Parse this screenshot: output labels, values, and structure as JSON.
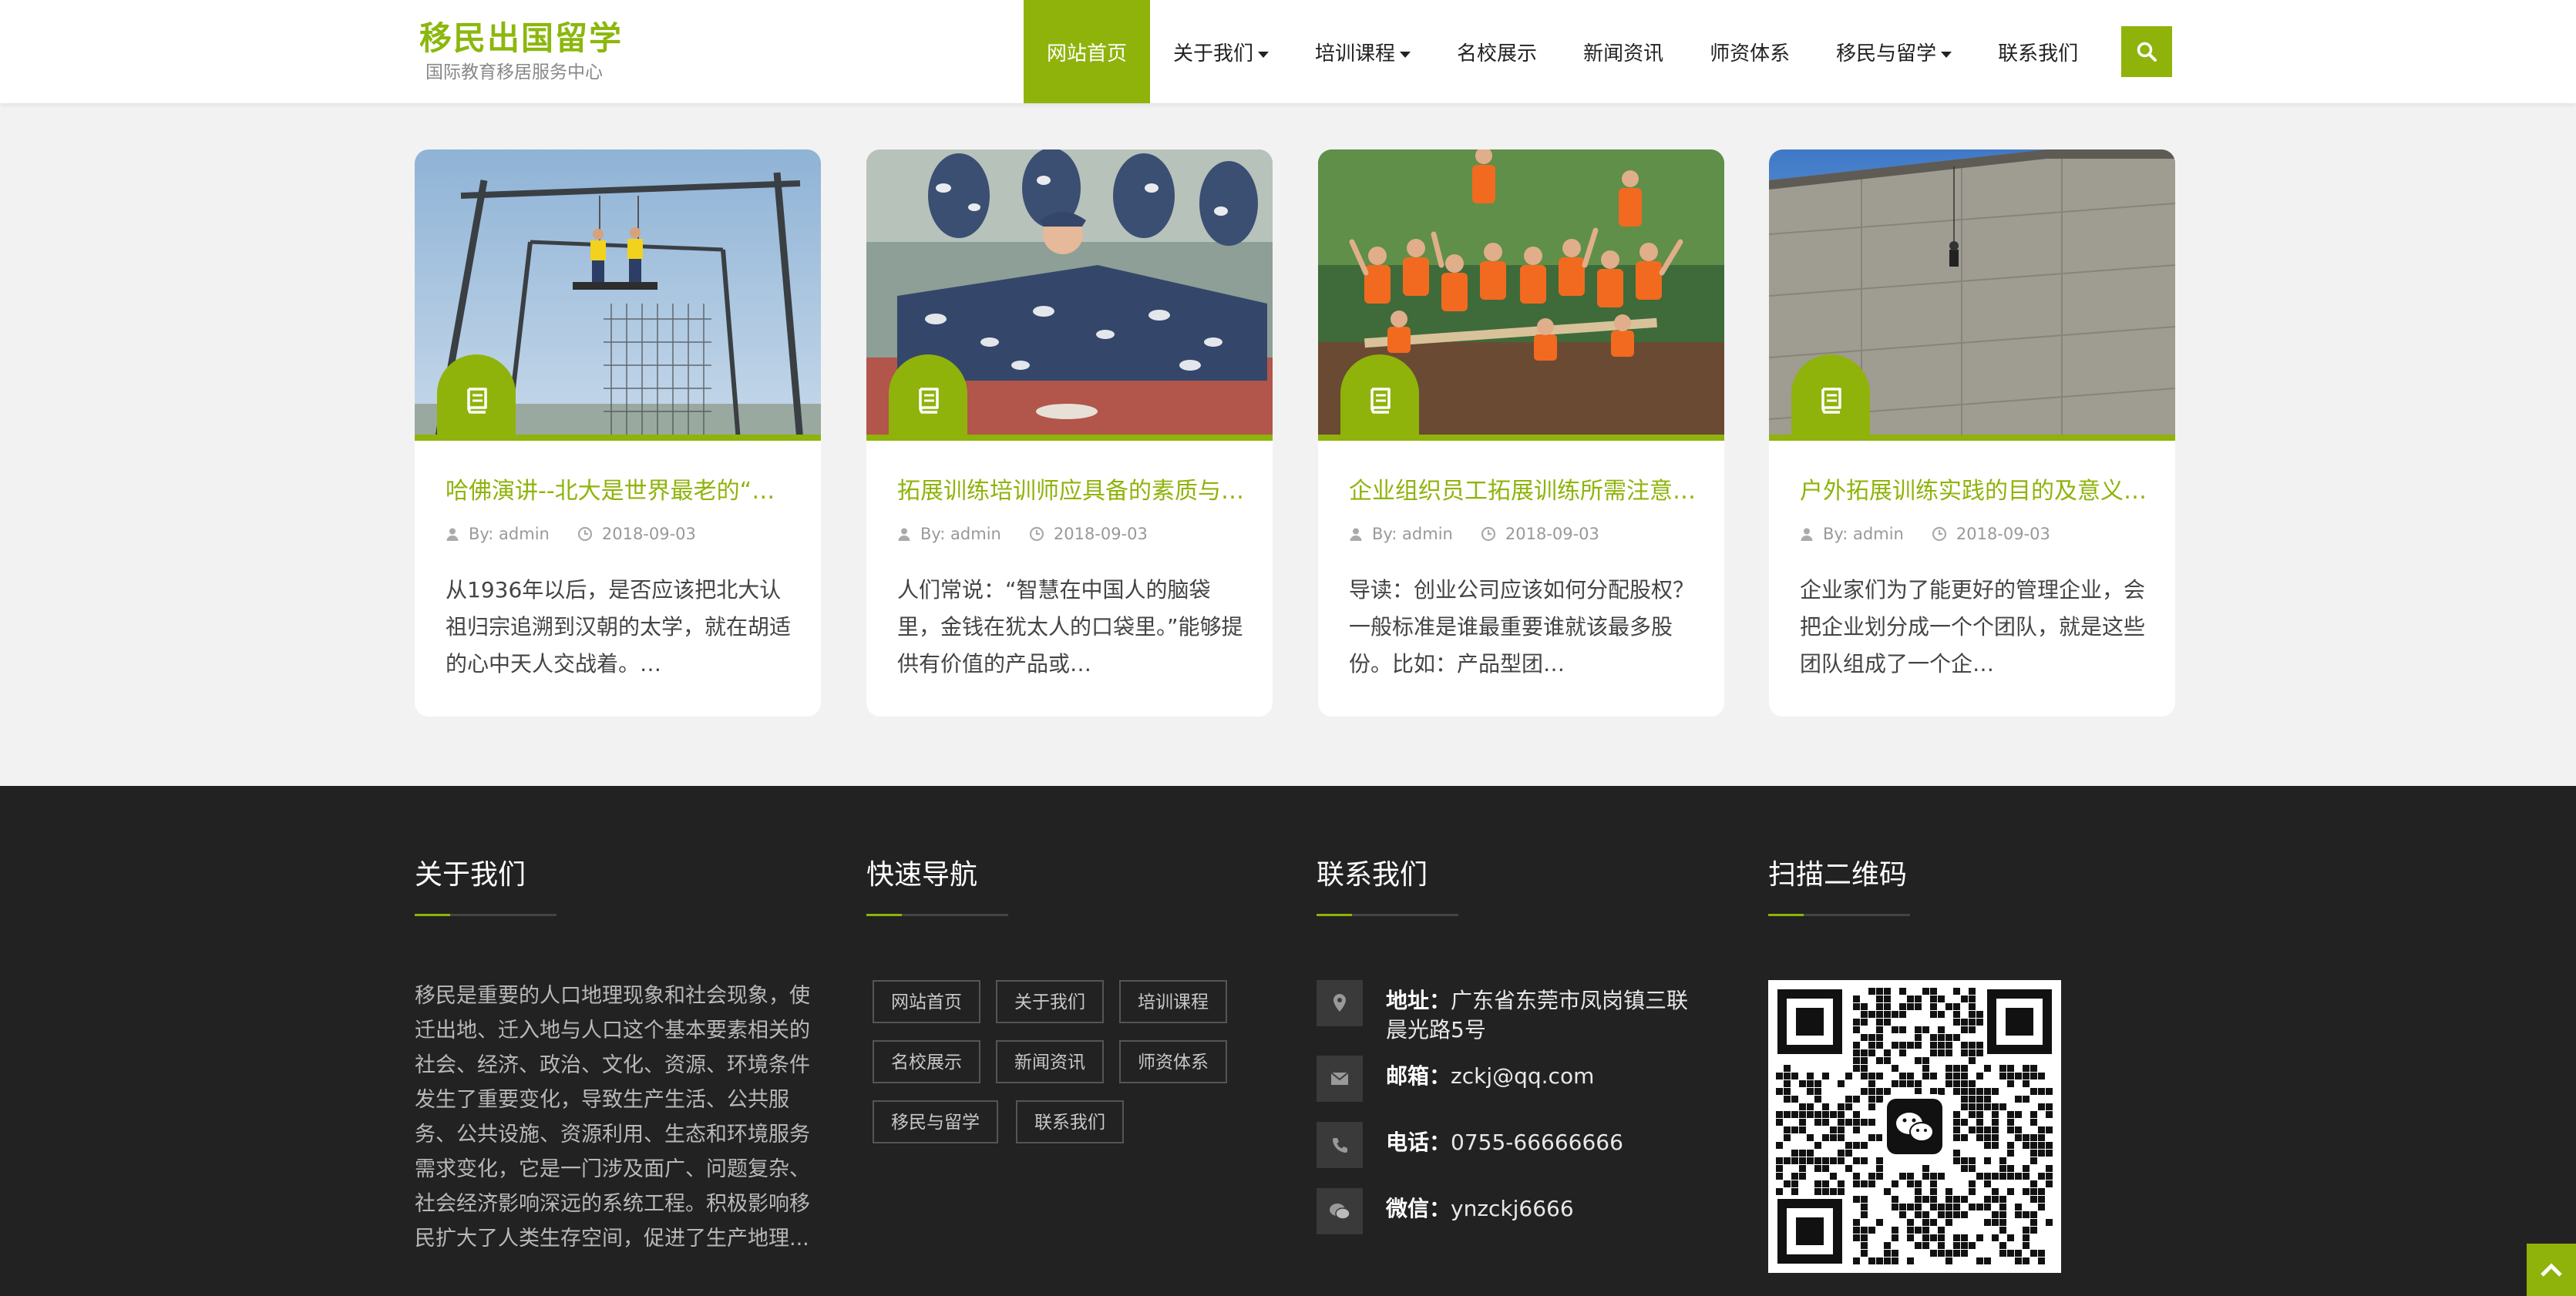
{
  "colors": {
    "accent": "#8fb30b",
    "footer_bg": "#222222"
  },
  "logo": {
    "title": "移民出国留学",
    "subtitle": "国际教育移居服务中心"
  },
  "nav": {
    "items": [
      {
        "label": "网站首页",
        "active": true
      },
      {
        "label": "关于我们",
        "dropdown": true
      },
      {
        "label": "培训课程",
        "dropdown": true
      },
      {
        "label": "名校展示"
      },
      {
        "label": "新闻资讯"
      },
      {
        "label": "师资体系"
      },
      {
        "label": "移民与留学",
        "dropdown": true
      },
      {
        "label": "联系我们"
      }
    ],
    "search_icon": "search-icon"
  },
  "cards": [
    {
      "title": "哈佛演讲--北大是世界最老的“大学”",
      "author": "By: admin",
      "date": "2018-09-03",
      "excerpt": "从1936年以后，是否应该把北大认祖归宗追溯到汉朝的太学，就在胡适的心中天人交战着。…",
      "badge_icon": "book-icon"
    },
    {
      "title": "拓展训练培训师应具备的素质与能力",
      "author": "By: admin",
      "date": "2018-09-03",
      "excerpt": "人们常说：“智慧在中国人的脑袋里，金钱在犹太人的口袋里。”能够提供有价值的产品或…",
      "badge_icon": "book-icon"
    },
    {
      "title": "企业组织员工拓展训练所需注意的事项",
      "author": "By: admin",
      "date": "2018-09-03",
      "excerpt": "导读：创业公司应该如何分配股权？一般标准是谁最重要谁就该最多股份。比如：产品型团…",
      "badge_icon": "book-icon"
    },
    {
      "title": "户外拓展训练实践的目的及意义是什么",
      "author": "By: admin",
      "date": "2018-09-03",
      "excerpt": "企业家们为了能更好的管理企业，会把企业划分成一个个团队，就是这些团队组成了一个企…",
      "badge_icon": "book-icon"
    }
  ],
  "footer": {
    "about": {
      "heading": "关于我们",
      "text": "移民是重要的人口地理现象和社会现象，使迁出地、迁入地与人口这个基本要素相关的社会、经济、政治、文化、资源、环境条件发生了重要变化，导致生产生活、公共服务、公共设施、资源利用、生态和环境服务需求变化，它是一门涉及面广、问题复杂、社会经济影响深远的系统工程。积极影响移民扩大了人类生存空间，促进了生产地理..."
    },
    "quicknav": {
      "heading": "快速导航",
      "links": [
        "网站首页",
        "关于我们",
        "培训课程",
        "名校展示",
        "新闻资讯",
        "师资体系",
        "移民与留学",
        "联系我们"
      ]
    },
    "contact": {
      "heading": "联系我们",
      "items": [
        {
          "label": "地址：",
          "value": "广东省东莞市凤岗镇三联晨光路5号",
          "icon": "location-icon"
        },
        {
          "label": "邮箱：",
          "value": "zckj@qq.com",
          "icon": "mail-icon"
        },
        {
          "label": "电话：",
          "value": "0755-66666666",
          "icon": "phone-icon"
        },
        {
          "label": "微信：",
          "value": "ynzckj6666",
          "icon": "wechat-icon"
        }
      ]
    },
    "qr": {
      "heading": "扫描二维码",
      "center_icon": "wechat-icon"
    }
  }
}
